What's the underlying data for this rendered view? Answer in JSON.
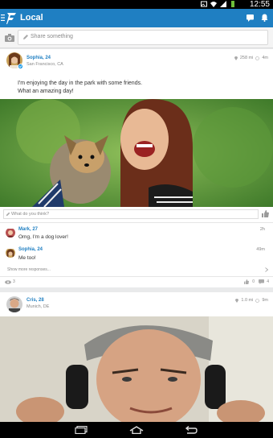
{
  "status_bar": {
    "time": "12:55"
  },
  "app_bar": {
    "title": "Local"
  },
  "share": {
    "placeholder": "Share something"
  },
  "post1": {
    "author": "Sophia, 24",
    "location": "San Francisco, CA",
    "distance": "258 mi",
    "age": "4m",
    "text_line1": "I'm enjoying the day in the park with some friends.",
    "text_line2": "What an amazing day!",
    "comment_placeholder": "What do you think?",
    "comments": [
      {
        "author": "Mark, 27",
        "time": "2h",
        "text": "Omg, I'm a dog lover!"
      },
      {
        "author": "Sophia, 24",
        "time": "49m",
        "text": "Me too!"
      }
    ],
    "more_label": "Show more responses...",
    "views": "3",
    "likes": "0",
    "comment_count": "4"
  },
  "post2": {
    "author": "Cris, 28",
    "location": "Munich, DE",
    "distance": "1.0 mi",
    "age": "9m"
  },
  "colors": {
    "brand": "#1f7fc2",
    "status_bar": "#000000"
  }
}
